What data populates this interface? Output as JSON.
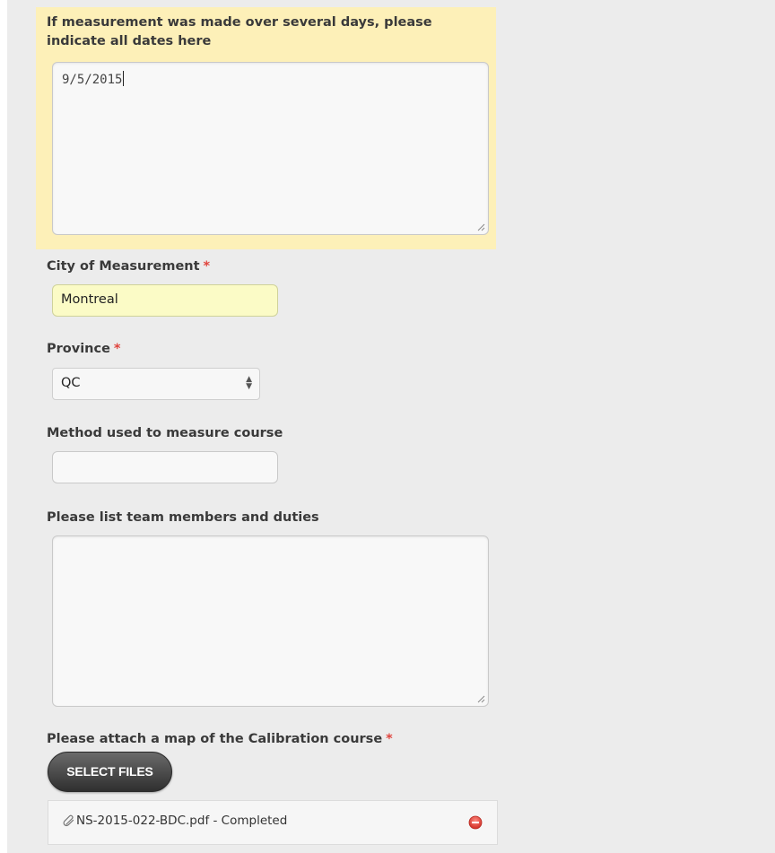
{
  "dates_field": {
    "label_line1": "If measurement was made over several days, please",
    "label_line2": "indicate all dates here",
    "value": "9/5/2015"
  },
  "city_field": {
    "label": "City of Measurement",
    "required_mark": "*",
    "value": "Montreal"
  },
  "province_field": {
    "label": "Province",
    "required_mark": "*",
    "selected": "QC"
  },
  "method_field": {
    "label": "Method used to measure course",
    "value": ""
  },
  "team_field": {
    "label": "Please list team members and duties",
    "value": ""
  },
  "map_upload": {
    "label": "Please attach a map of the Calibration course",
    "required_mark": "*",
    "button_label": "SELECT FILES",
    "files": [
      {
        "name": "NS-2015-022-BDC.pdf",
        "status_text": " - Completed"
      }
    ]
  },
  "colors": {
    "highlight": "#fdf0b8",
    "filled_input": "#fbfbc6",
    "required": "#e0443d",
    "page_background": "#ececec"
  }
}
